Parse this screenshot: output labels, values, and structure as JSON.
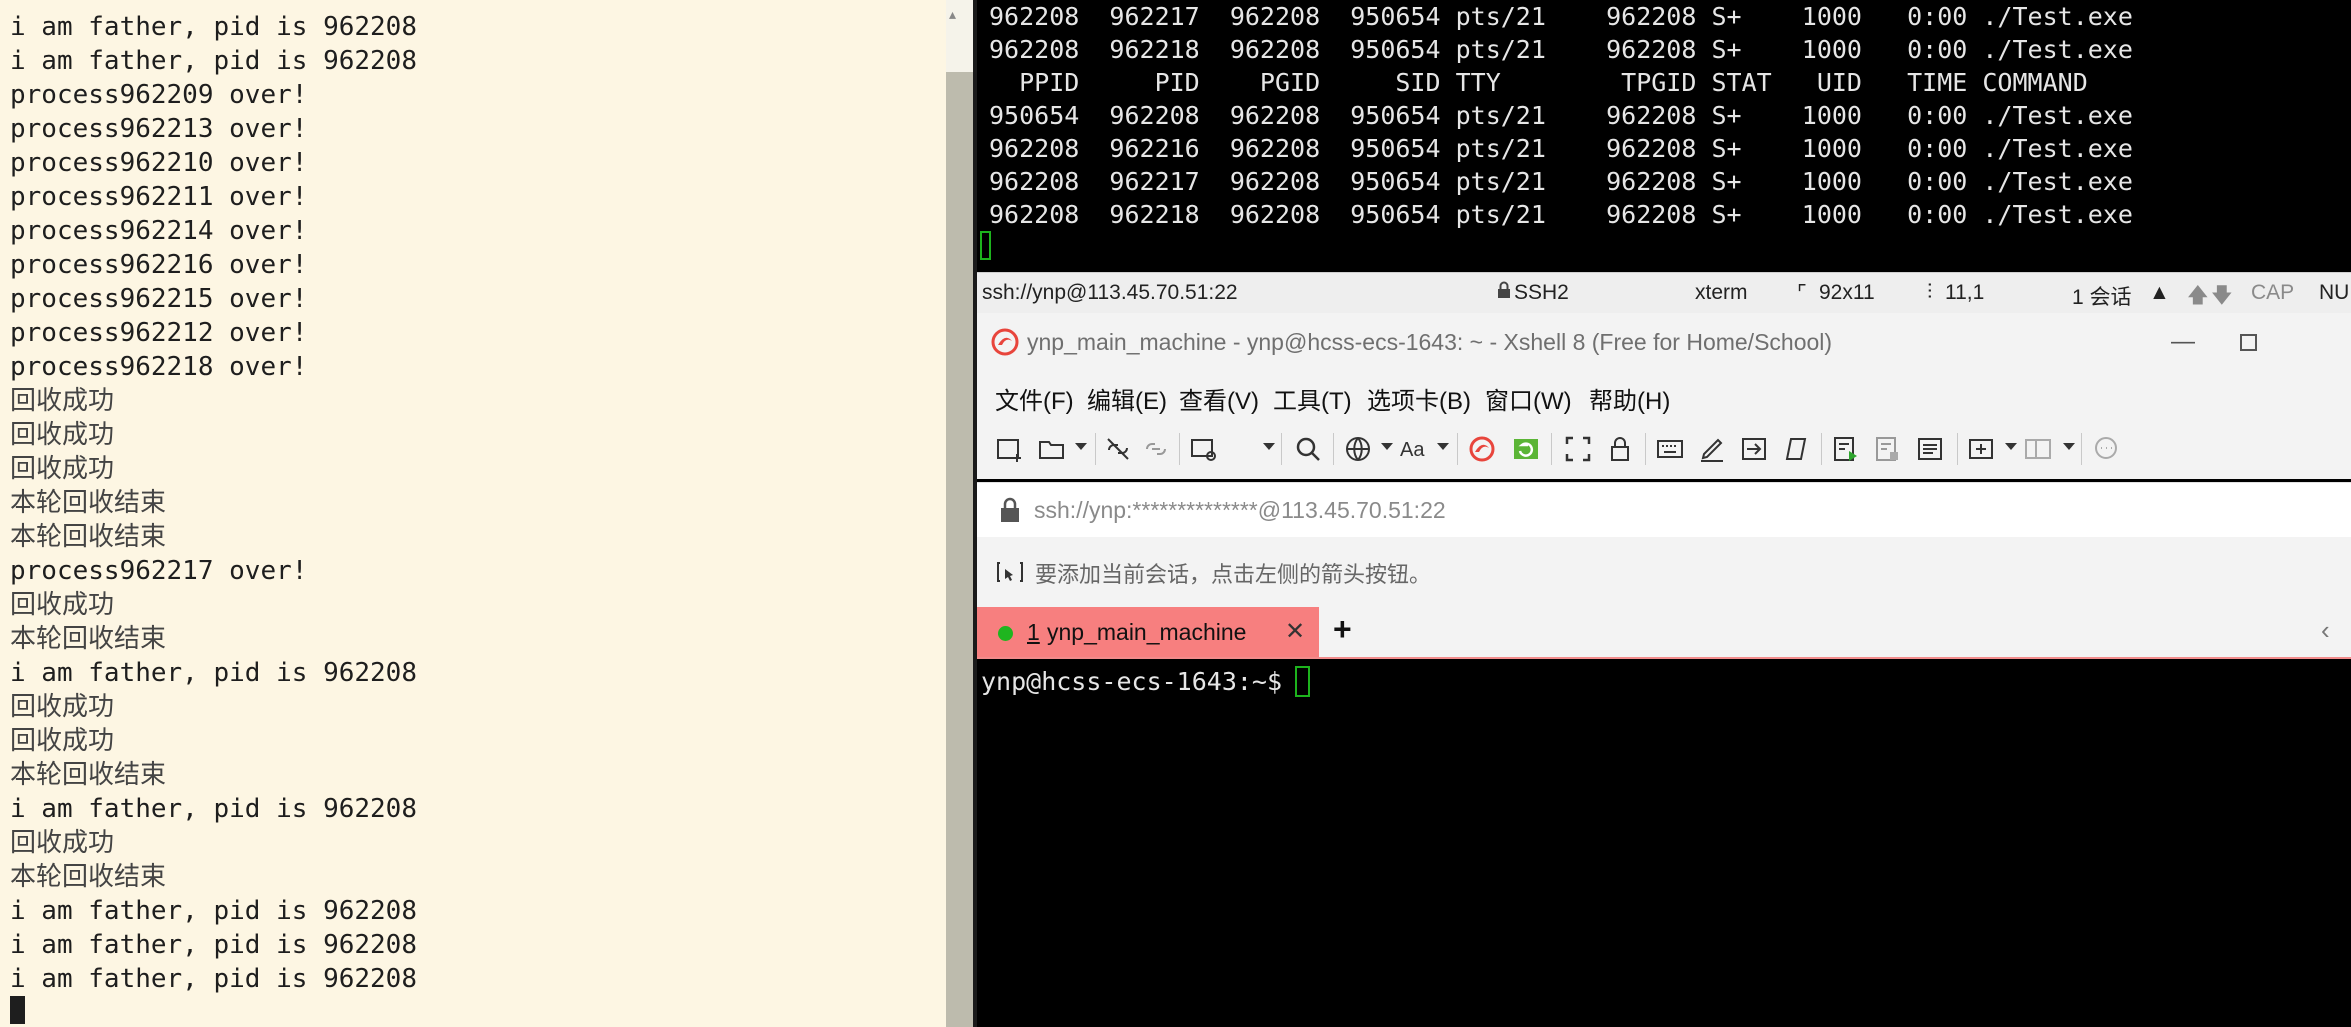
{
  "left_terminal": {
    "lines": [
      "i am father, pid is 962208",
      "i am father, pid is 962208",
      "process962209 over!",
      "process962213 over!",
      "process962210 over!",
      "process962211 over!",
      "process962214 over!",
      "process962216 over!",
      "process962215 over!",
      "process962212 over!",
      "process962218 over!",
      "回收成功",
      "回收成功",
      "回收成功",
      "本轮回收结束",
      "本轮回收结束",
      "process962217 over!",
      "回收成功",
      "本轮回收结束",
      "i am father, pid is 962208",
      "回收成功",
      "回收成功",
      "本轮回收结束",
      "i am father, pid is 962208",
      "回收成功",
      "本轮回收结束",
      "i am father, pid is 962208",
      "i am father, pid is 962208",
      "i am father, pid is 962208"
    ]
  },
  "top_terminal": {
    "lines": [
      "962208  962217  962208  950654 pts/21    962208 S+    1000   0:00 ./Test.exe",
      "962208  962218  962208  950654 pts/21    962208 S+    1000   0:00 ./Test.exe",
      "  PPID     PID    PGID     SID TTY        TPGID STAT   UID   TIME COMMAND",
      "950654  962208  962208  950654 pts/21    962208 S+    1000   0:00 ./Test.exe",
      "962208  962216  962208  950654 pts/21    962208 S+    1000   0:00 ./Test.exe",
      "962208  962217  962208  950654 pts/21    962208 S+    1000   0:00 ./Test.exe",
      "962208  962218  962208  950654 pts/21    962208 S+    1000   0:00 ./Test.exe"
    ]
  },
  "status_bar": {
    "connection": "ssh://ynp@113.45.70.51:22",
    "protocol": "SSH2",
    "terminal_type": "xterm",
    "size": "92x11",
    "cursor_pos": "11,1",
    "sessions": "1 会话",
    "caps": "CAP",
    "num": "NU"
  },
  "window": {
    "title": "ynp_main_machine - ynp@hcss-ecs-1643: ~ - Xshell 8 (Free for Home/School)"
  },
  "menu": {
    "items": [
      "文件(F)",
      "编辑(E)",
      "查看(V)",
      "工具(T)",
      "选项卡(B)",
      "窗口(W)",
      "帮助(H)"
    ]
  },
  "address": {
    "value": "ssh://ynp:**************@113.45.70.51:22"
  },
  "hint": {
    "text": "要添加当前会话，点击左侧的箭头按钮。"
  },
  "tabs": {
    "active": {
      "number": "1",
      "label": "ynp_main_machine"
    },
    "add_label": "+"
  },
  "bottom_terminal": {
    "prompt": "ynp@hcss-ecs-1643:~$ "
  },
  "colors": {
    "left_bg": "#fdf6e3",
    "tab_active": "#f77f7f",
    "cursor_green": "#1db31d"
  }
}
